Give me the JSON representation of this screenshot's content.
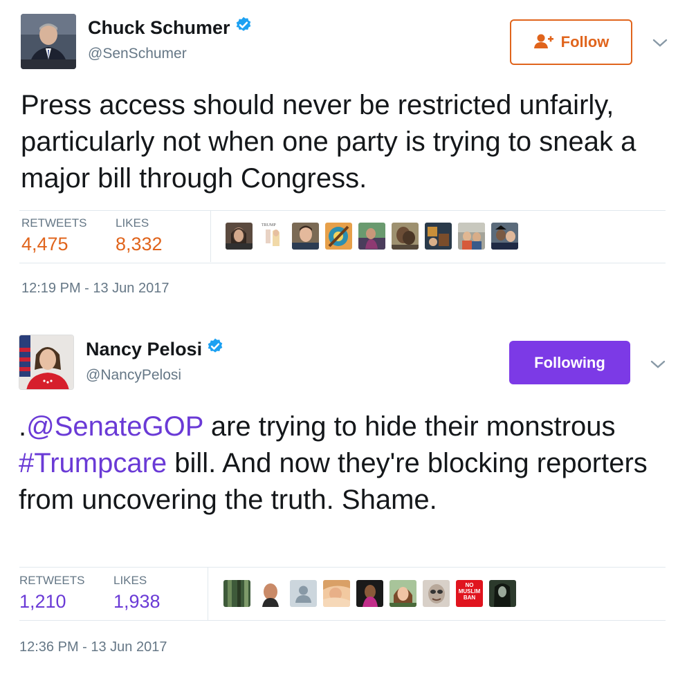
{
  "tweets": [
    {
      "name": "Chuck Schumer",
      "handle": "@SenSchumer",
      "follow_label": "Follow",
      "follow_state": "not-following",
      "text_segments": [
        {
          "type": "text",
          "value": "Press access should never be restricted unfairly, particularly not when one party is trying to sneak a major bill through Congress."
        }
      ],
      "retweets_label": "RETWEETS",
      "retweets": "4,475",
      "likes_label": "LIKES",
      "likes": "8,332",
      "stat_color": "#e0641c",
      "likers": [
        "liker-avatar",
        "trump-book-avatar",
        "liker-avatar",
        "liker-avatar",
        "liker-avatar",
        "liker-avatar",
        "liker-avatar",
        "liker-avatar",
        "liker-avatar"
      ],
      "likers_labels": [
        "",
        "TRUMP",
        "",
        "",
        "",
        "",
        "",
        "",
        ""
      ],
      "timestamp": "12:19 PM - 13 Jun 2017"
    },
    {
      "name": "Nancy Pelosi",
      "handle": "@NancyPelosi",
      "follow_label": "Following",
      "follow_state": "following",
      "text_segments": [
        {
          "type": "text",
          "value": "."
        },
        {
          "type": "mention",
          "value": "@SenateGOP"
        },
        {
          "type": "text",
          "value": " are trying to hide their monstrous "
        },
        {
          "type": "hashtag",
          "value": "#Trumpcare"
        },
        {
          "type": "text",
          "value": " bill. And now they're blocking reporters from uncovering the truth. Shame."
        }
      ],
      "retweets_label": "RETWEETS",
      "retweets": "1,210",
      "likes_label": "LIKES",
      "likes": "1,938",
      "stat_color": "#6a3ad6",
      "likers": [
        "liker-avatar",
        "liker-avatar",
        "default-user-avatar",
        "liker-avatar",
        "liker-avatar",
        "liker-avatar",
        "liker-avatar",
        "no-muslim-ban-avatar",
        "liker-avatar"
      ],
      "likers_labels": [
        "",
        "",
        "",
        "",
        "",
        "",
        "",
        "NO MUSLIM BAN",
        ""
      ],
      "timestamp": "12:36 PM - 13 Jun 2017"
    }
  ],
  "colors": {
    "orange_accent": "#e0641c",
    "purple_accent": "#6a3ad6",
    "purple_button": "#7c3ae6",
    "verified_blue": "#1da1f2",
    "muted_text": "#657786"
  }
}
